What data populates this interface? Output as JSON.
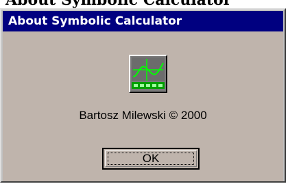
{
  "window": {
    "title": "About Symbolic Calculator"
  },
  "background": {
    "partial_heading": "About Symbolic Calculator"
  },
  "dialog": {
    "icon": "graph-icon",
    "credit": "Bartosz Milewski © 2000",
    "ok_label": "OK"
  },
  "colors": {
    "titlebar": "#000080",
    "face": "#bfb4ac",
    "icon_plot": "#00ff00",
    "icon_bg": "#7a7a7a"
  }
}
